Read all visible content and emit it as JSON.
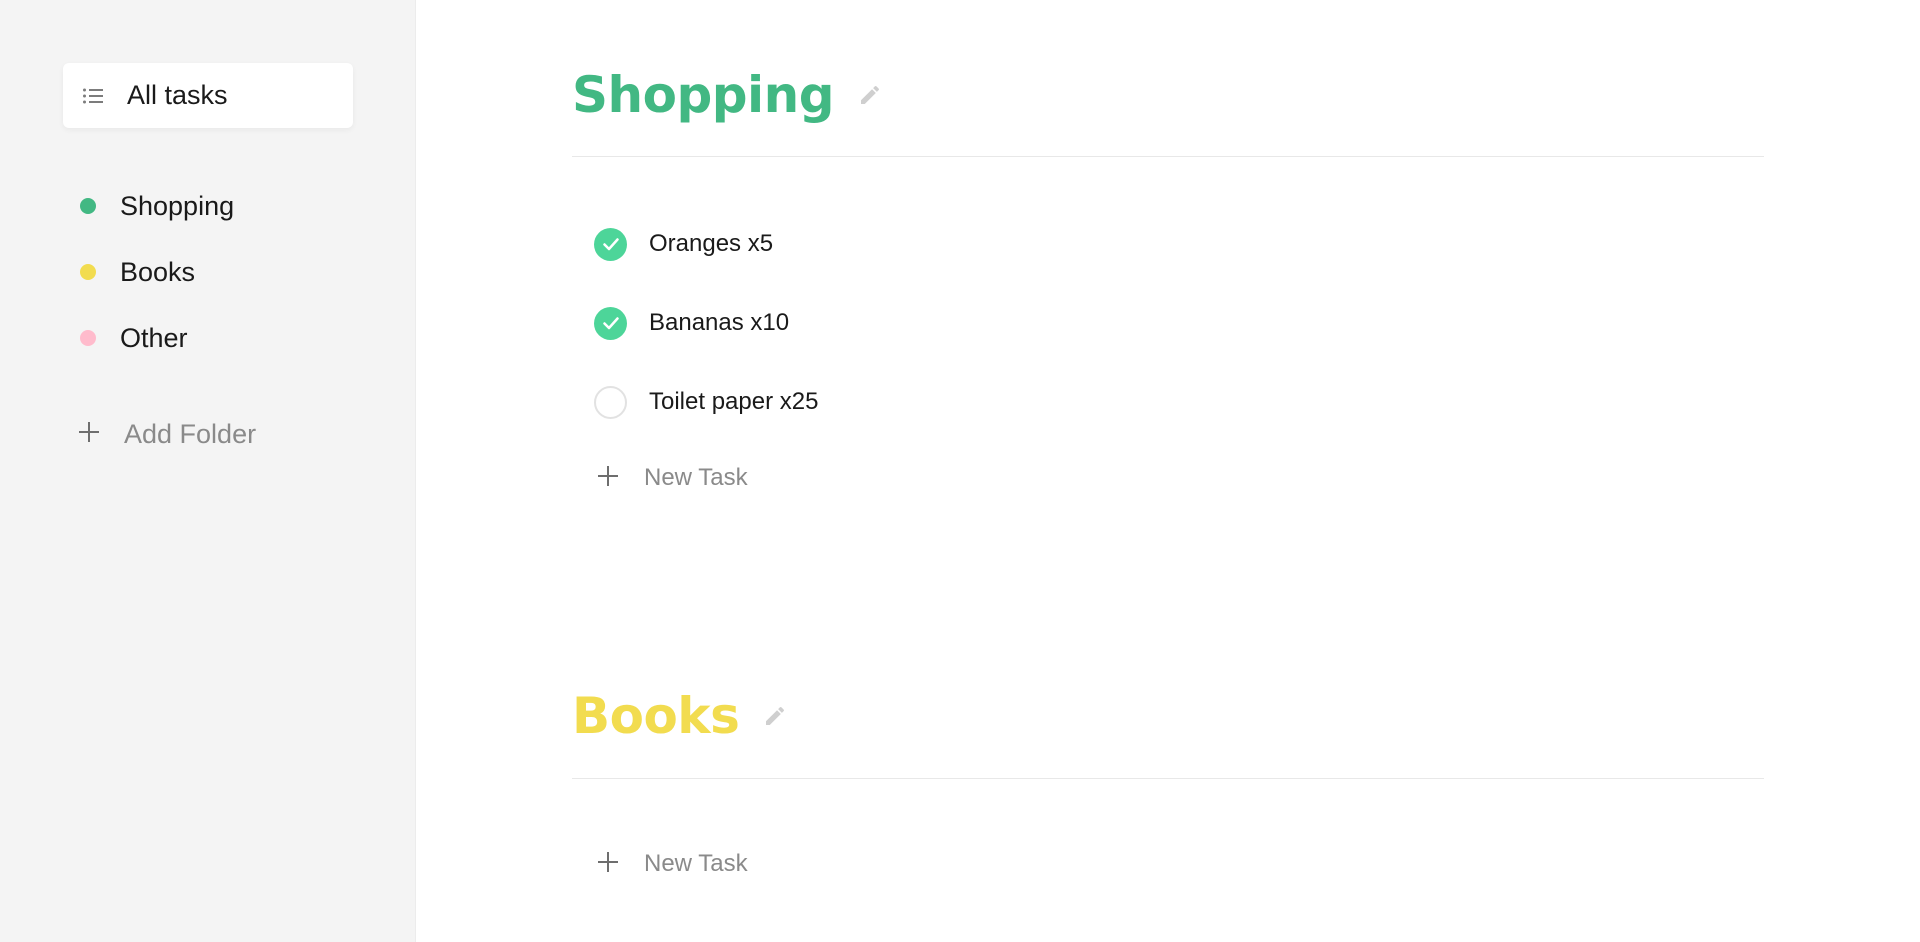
{
  "sidebar": {
    "all_tasks_label": "All tasks",
    "all_tasks_icon": "list-icon",
    "folders": [
      {
        "label": "Shopping",
        "color": "#42b883"
      },
      {
        "label": "Books",
        "color": "#f2dc4f"
      },
      {
        "label": "Other",
        "color": "#ffbbcc"
      }
    ],
    "add_folder_label": "Add Folder",
    "add_folder_icon": "plus-icon"
  },
  "lists": [
    {
      "title": "Shopping",
      "color": "#42b883",
      "edit_icon": "pencil-icon",
      "tasks": [
        {
          "text": "Oranges x5",
          "completed": true
        },
        {
          "text": "Bananas x10",
          "completed": true
        },
        {
          "text": "Toilet paper x25",
          "completed": false
        }
      ],
      "new_task_label": "New Task"
    },
    {
      "title": "Books",
      "color": "#f2dc4f",
      "edit_icon": "pencil-icon",
      "tasks": [],
      "new_task_label": "New Task"
    }
  ],
  "colors": {
    "check_done": "#4dd599",
    "muted_text": "#8a8a8a",
    "sidebar_bg": "#f4f4f4"
  }
}
